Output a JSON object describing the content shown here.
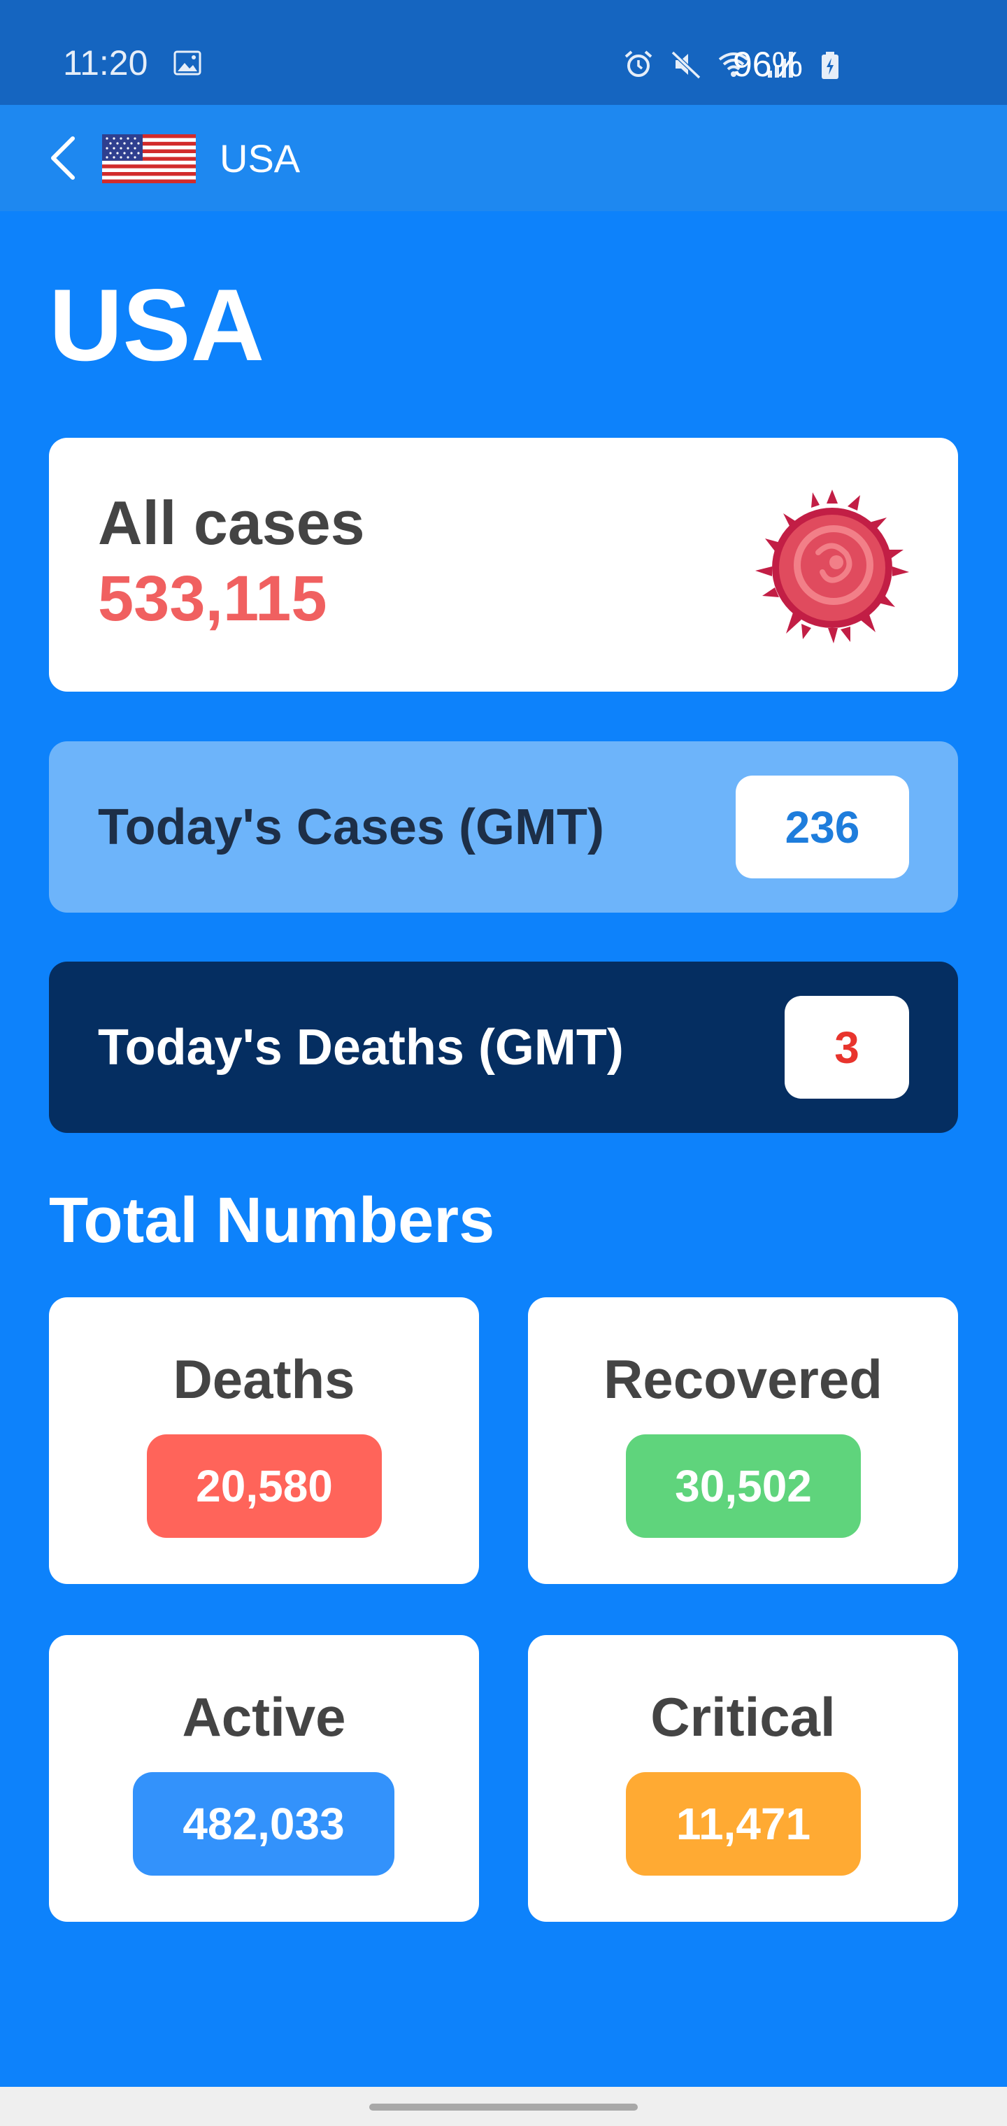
{
  "status_bar": {
    "time": "11:20",
    "battery_text": "96%",
    "icons": [
      "gallery-icon",
      "alarm-icon",
      "mute-icon",
      "wifi-icon",
      "signal-icon",
      "battery-charging-icon"
    ]
  },
  "app_bar": {
    "title": "USA",
    "back_icon": "chevron-left-icon",
    "flag_icon": "us-flag-icon"
  },
  "page": {
    "title": "USA"
  },
  "all_cases": {
    "label": "All cases",
    "value": "533,115",
    "icon": "virus-icon"
  },
  "today": {
    "cases_label": "Today's Cases (GMT)",
    "cases_value": "236",
    "deaths_label": "Today's Deaths (GMT)",
    "deaths_value": "3"
  },
  "totals": {
    "title": "Total Numbers",
    "stats": [
      {
        "label": "Deaths",
        "value": "20,580"
      },
      {
        "label": "Recovered",
        "value": "30,502"
      },
      {
        "label": "Active",
        "value": "482,033"
      },
      {
        "label": "Critical",
        "value": "11,471"
      }
    ]
  },
  "colors": {
    "background": "#0D82FB",
    "status_bar": "#1565C0",
    "app_bar": "#1E88F0",
    "all_cases_value": "#F06060",
    "today_cases_bg": "#6DB4FA",
    "today_deaths_bg": "#052E61",
    "deaths_badge": "#FF645A",
    "recovered_badge": "#5FD47C",
    "active_badge": "#3392FB",
    "critical_badge": "#FFAA33"
  }
}
